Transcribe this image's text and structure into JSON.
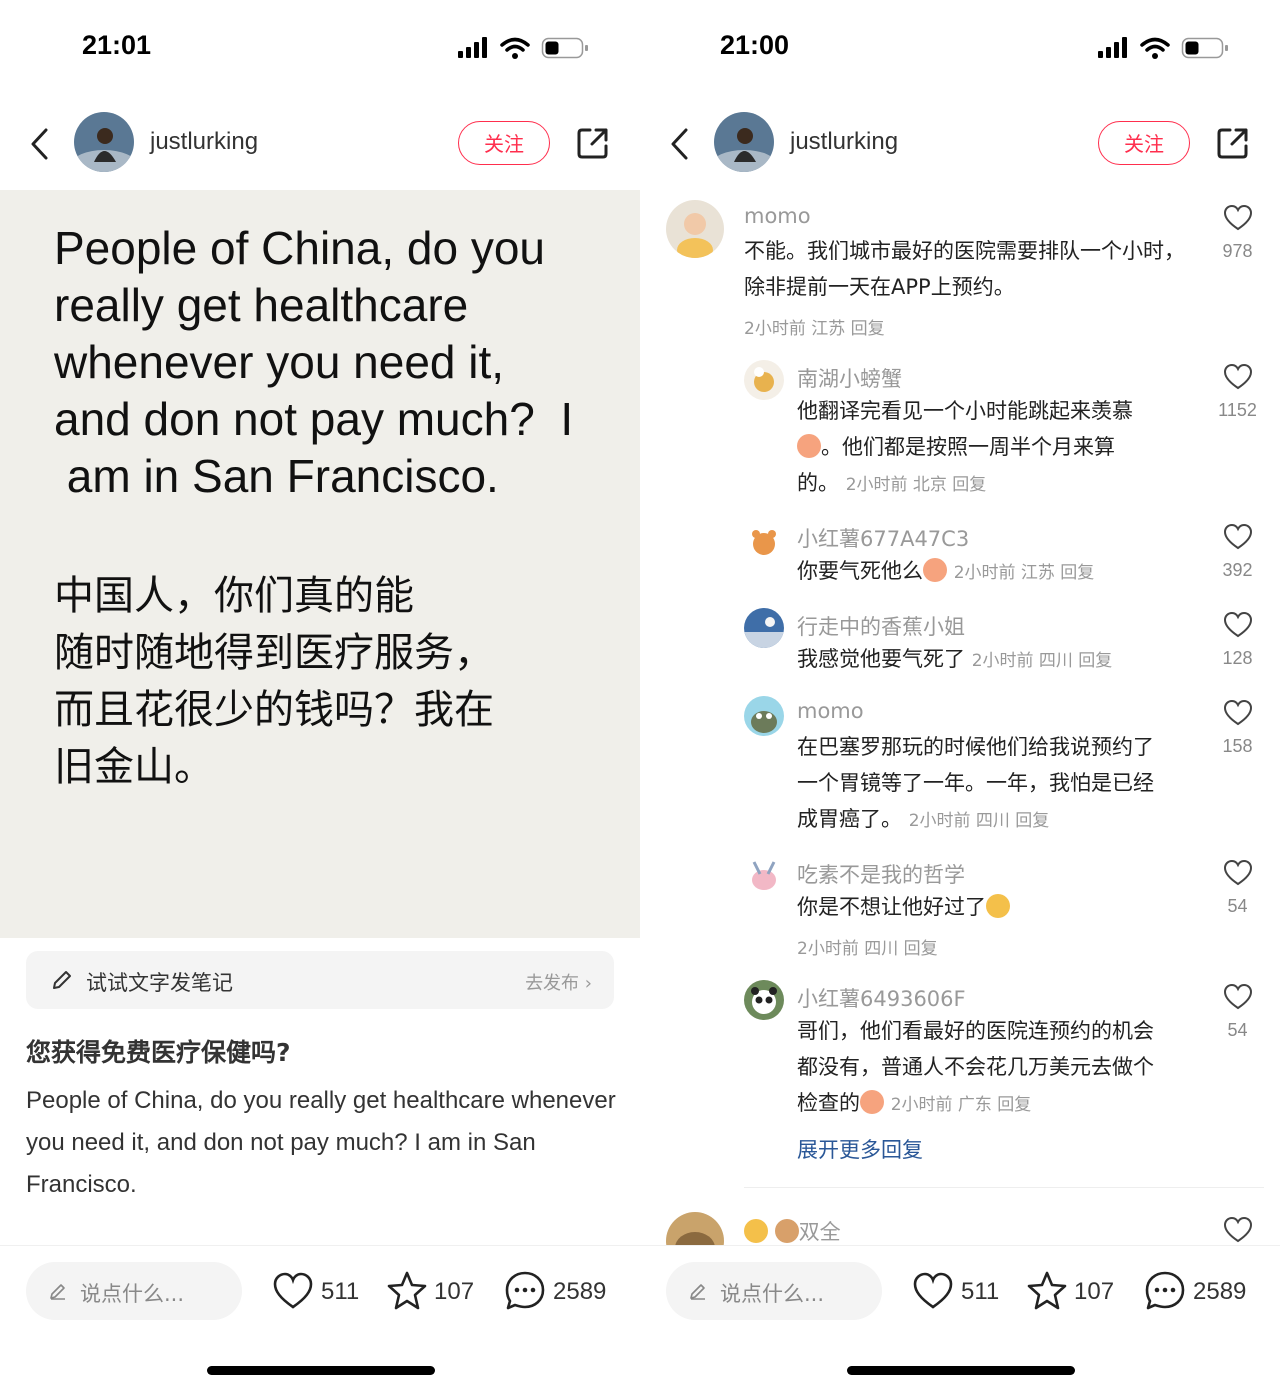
{
  "left": {
    "status": {
      "time": "21:01"
    },
    "header": {
      "username": "justlurking",
      "follow_label": "关注"
    },
    "post_image": {
      "english": "People of China, do you\nreally get healthcare\nwhenever you need it,\nand don not pay much?  I\n am in San Francisco.",
      "chinese": "中国人，你们真的能\n随时随地得到医疗服务，\n而且花很少的钱吗？我在\n旧金山。"
    },
    "try_text_note": {
      "label": "试试文字发笔记",
      "action": "去发布"
    },
    "note": {
      "title": "您获得免费医疗保健吗?",
      "body": "People of China, do you really get healthcare whenever you need it, and don not pay much?  I am in San Francisco."
    },
    "bottom_bar": {
      "input_placeholder": "说点什么...",
      "likes": "511",
      "stars": "107",
      "comments": "2589"
    }
  },
  "right": {
    "status": {
      "time": "21:00"
    },
    "header": {
      "username": "justlurking",
      "follow_label": "关注"
    },
    "comments": [
      {
        "name": "momo",
        "text": "不能。我们城市最好的医院需要排队一个小时，除非提前一天在APP上预约。",
        "meta": "2小时前 江苏 回复",
        "likes": "978"
      },
      {
        "name": "南湖小螃蟹",
        "text": "他翻译完看见一个小时能跳起来羡慕",
        "text2": "。他们都是按照一周半个月来算",
        "text3": "的。",
        "meta": "2小时前 北京 回复",
        "likes": "1152"
      },
      {
        "name": "小红薯677A47C3",
        "text": "你要气死他么",
        "meta": "2小时前 江苏 回复",
        "likes": "392"
      },
      {
        "name": "行走中的香蕉小姐",
        "text": "我感觉他要气死了",
        "meta": "2小时前 四川 回复",
        "likes": "128"
      },
      {
        "name": "momo",
        "text": "在巴塞罗那玩的时候他们给我说预约了",
        "text2": "一个胃镜等了一年。一年，我怕是已经",
        "text3": "成胃癌了。",
        "meta": "2小时前 四川 回复",
        "likes": "158"
      },
      {
        "name": "吃素不是我的哲学",
        "text": "你是不想让他好过了",
        "meta": "2小时前 四川 回复",
        "likes": "54"
      },
      {
        "name": "小红薯6493606F",
        "text": "哥们，他们看最好的医院连预约的机会",
        "text2": "都没有，普通人不会花几万美元去做个",
        "text3": "检查的",
        "meta": "2小时前 广东 回复",
        "likes": "54"
      }
    ],
    "expand_label": "展开更多回复",
    "next_comment_name": "双全",
    "bottom_bar": {
      "input_placeholder": "说点什么...",
      "likes": "511",
      "stars": "107",
      "comments": "2589"
    }
  }
}
